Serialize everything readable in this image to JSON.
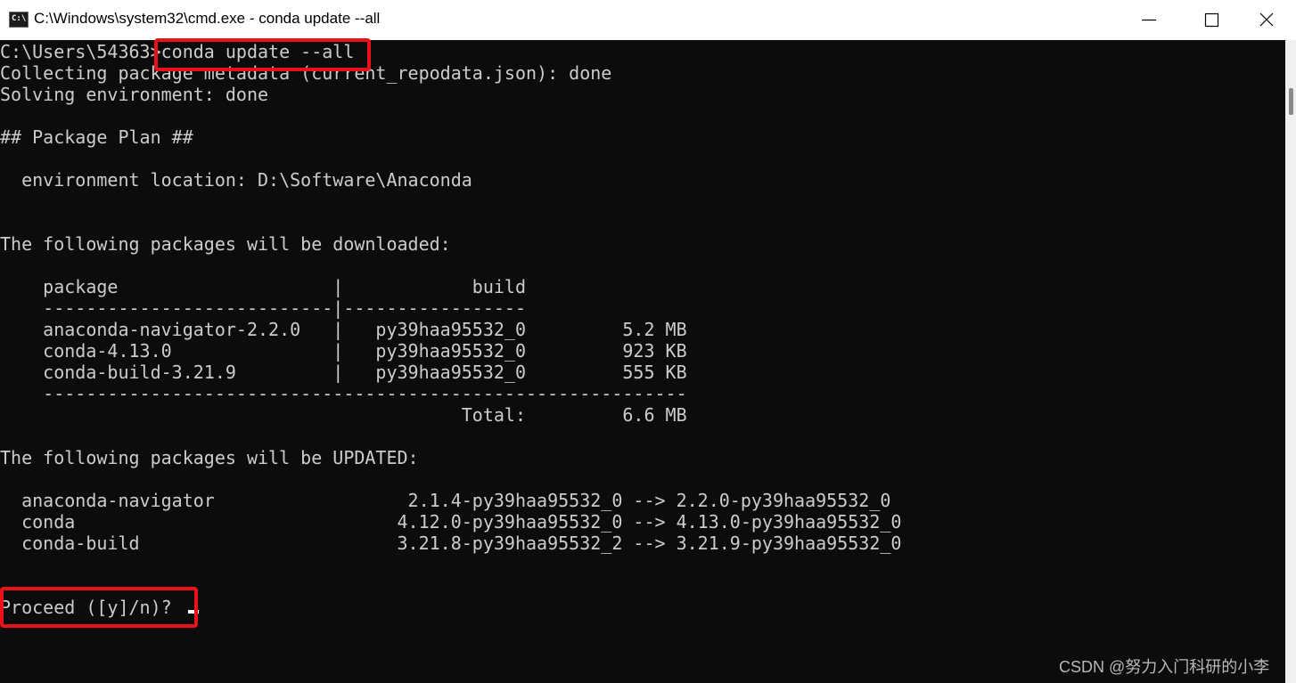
{
  "window": {
    "title": "C:\\Windows\\system32\\cmd.exe - conda  update --all",
    "icon_label": "C:\\",
    "icon": "terminal-icon",
    "controls": [
      "minimize-icon",
      "maximize-icon",
      "close-icon"
    ]
  },
  "console": {
    "lines": [
      "C:\\Users\\54363>conda update --all",
      "Collecting package metadata (current_repodata.json): done",
      "Solving environment: done",
      "",
      "## Package Plan ##",
      "",
      "  environment location: D:\\Software\\Anaconda",
      "",
      "",
      "The following packages will be downloaded:",
      "",
      "    package                    |            build",
      "    ---------------------------|-----------------",
      "    anaconda-navigator-2.2.0   |   py39haa95532_0         5.2 MB",
      "    conda-4.13.0               |   py39haa95532_0         923 KB",
      "    conda-build-3.21.9         |   py39haa95532_0         555 KB",
      "    ------------------------------------------------------------",
      "                                           Total:         6.6 MB",
      "",
      "The following packages will be UPDATED:",
      "",
      "  anaconda-navigator                  2.1.4-py39haa95532_0 --> 2.2.0-py39haa95532_0",
      "  conda                              4.12.0-py39haa95532_0 --> 4.13.0-py39haa95532_0",
      "  conda-build                        3.21.8-py39haa95532_2 --> 3.21.9-py39haa95532_0",
      "",
      "",
      "Proceed ([y]/n)? "
    ]
  },
  "colors": {
    "console_bg": "#0c0c0c",
    "console_fg": "#cccccc",
    "highlight": "#e8121c"
  },
  "watermark": "CSDN @努力入门科研的小李"
}
